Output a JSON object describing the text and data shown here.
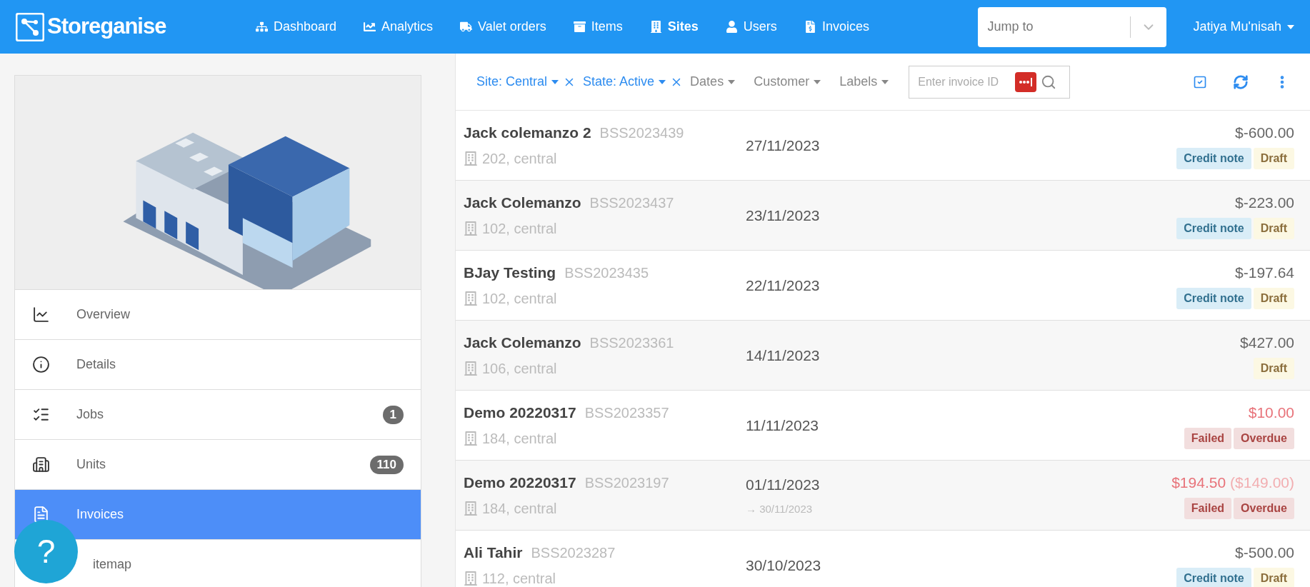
{
  "header": {
    "logo": "Storeganise",
    "nav": [
      {
        "label": "Dashboard",
        "selected": false
      },
      {
        "label": "Analytics",
        "selected": false
      },
      {
        "label": "Valet orders",
        "selected": false
      },
      {
        "label": "Items",
        "selected": false
      },
      {
        "label": "Sites",
        "selected": true
      },
      {
        "label": "Users",
        "selected": false
      },
      {
        "label": "Invoices",
        "selected": false
      }
    ],
    "jump_to": {
      "placeholder": "Jump to"
    },
    "user": "Jatiya Mu'nisah"
  },
  "sidebar": {
    "items": [
      {
        "label": "Overview",
        "selected": false
      },
      {
        "label": "Details",
        "selected": false
      },
      {
        "label": "Jobs",
        "selected": false,
        "count": "1"
      },
      {
        "label": "Units",
        "selected": false,
        "count": "110"
      },
      {
        "label": "Invoices",
        "selected": true
      },
      {
        "label": "itemap",
        "selected": false
      }
    ]
  },
  "help_button": "?",
  "filters": [
    {
      "label": "Site: Central",
      "active": true
    },
    {
      "label": "State: Active",
      "active": true
    },
    {
      "label": "Dates",
      "active": false
    },
    {
      "label": "Customer",
      "active": false
    },
    {
      "label": "Labels",
      "active": false
    }
  ],
  "search": {
    "placeholder": "Enter invoice ID"
  },
  "invoices": [
    {
      "name": "Jack colemanzo 2",
      "number": "BSS2023439",
      "unit": "202, central",
      "date": "27/11/2023",
      "amount": "$-600.00",
      "failed": false,
      "badges": [
        {
          "label": "Credit note",
          "kind": "info"
        },
        {
          "label": "Draft",
          "kind": "warning"
        }
      ]
    },
    {
      "name": "Jack Colemanzo",
      "number": "BSS2023437",
      "unit": "102, central",
      "date": "23/11/2023",
      "amount": "$-223.00",
      "failed": false,
      "badges": [
        {
          "label": "Credit note",
          "kind": "info"
        },
        {
          "label": "Draft",
          "kind": "warning"
        }
      ]
    },
    {
      "name": "BJay Testing",
      "number": "BSS2023435",
      "unit": "102, central",
      "date": "22/11/2023",
      "amount": "$-197.64",
      "failed": false,
      "badges": [
        {
          "label": "Credit note",
          "kind": "info"
        },
        {
          "label": "Draft",
          "kind": "warning"
        }
      ]
    },
    {
      "name": "Jack Colemanzo",
      "number": "BSS2023361",
      "unit": "106, central",
      "date": "14/11/2023",
      "amount": "$427.00",
      "failed": false,
      "badges": [
        {
          "label": "Draft",
          "kind": "warning"
        }
      ]
    },
    {
      "name": "Demo 20220317",
      "number": "BSS2023357",
      "unit": "184, central",
      "date": "11/11/2023",
      "amount": "$10.00",
      "failed": true,
      "badges": [
        {
          "label": "Failed",
          "kind": "danger"
        },
        {
          "label": "Overdue",
          "kind": "danger"
        }
      ]
    },
    {
      "name": "Demo 20220317",
      "number": "BSS2023197",
      "unit": "184, central",
      "date": "01/11/2023",
      "due": "→ 30/11/2023",
      "amount": "$194.50",
      "amount_note": "($149.00)",
      "failed": true,
      "badges": [
        {
          "label": "Failed",
          "kind": "danger"
        },
        {
          "label": "Overdue",
          "kind": "danger"
        }
      ]
    },
    {
      "name": "Ali Tahir",
      "number": "BSS2023287",
      "unit": "112, central",
      "date": "30/10/2023",
      "amount": "$-500.00",
      "failed": false,
      "badges": [
        {
          "label": "Credit note",
          "kind": "info"
        },
        {
          "label": "Draft",
          "kind": "warning"
        }
      ]
    }
  ]
}
